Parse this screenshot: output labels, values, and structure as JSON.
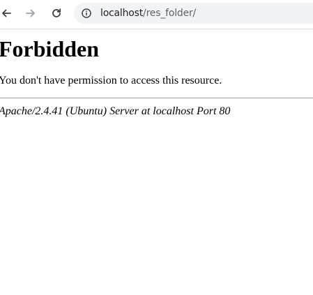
{
  "browser": {
    "url_host": "localhost",
    "url_path": "/res_folder/"
  },
  "page": {
    "heading": "Forbidden",
    "message": "You don't have permission to access this resource.",
    "server_signature": "Apache/2.4.41 (Ubuntu) Server at localhost Port 80"
  },
  "icons": {
    "back": "arrow-left-icon",
    "forward": "arrow-right-icon",
    "reload": "reload-icon",
    "site_info": "info-icon"
  }
}
